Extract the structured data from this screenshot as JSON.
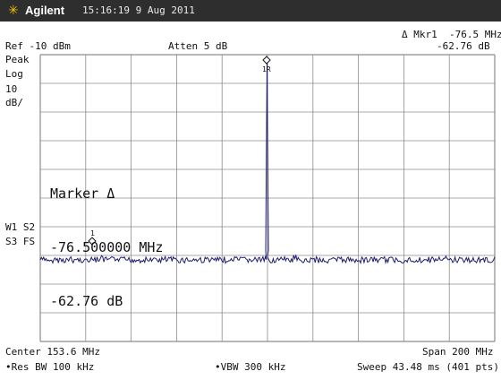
{
  "header": {
    "brand": "Agilent",
    "datetime": "15:16:19  9 Aug 2011",
    "icon": "agilent-spark-icon",
    "brand_color": "#f2c200"
  },
  "status": {
    "ref_level": "Ref -10 dBm",
    "atten": "Atten 5 dB",
    "marker_readout_freq": "Δ Mkr1  -76.5 MHz",
    "marker_readout_level": "-62.76 dB"
  },
  "left_annotations": {
    "peak": "Peak",
    "log": "Log",
    "scale_value": "10",
    "scale_unit": "dB/",
    "w1s2": "W1 S2",
    "s3fs": "S3 FS"
  },
  "marker_box": {
    "title": "Marker Δ",
    "freq": "-76.500000 MHz",
    "level": "-62.76 dB"
  },
  "markers": {
    "delta_label": "1",
    "ref_label": "1R"
  },
  "footer": {
    "center": "Center 153.6 MHz",
    "span": "Span 200 MHz",
    "res_bw": "•Res BW 100 kHz",
    "vbw": "•VBW 300 kHz",
    "sweep": "Sweep 43.48 ms (401 pts)"
  },
  "trace_color": "#1d1d6e",
  "grid_color": "#8c8c8c"
}
